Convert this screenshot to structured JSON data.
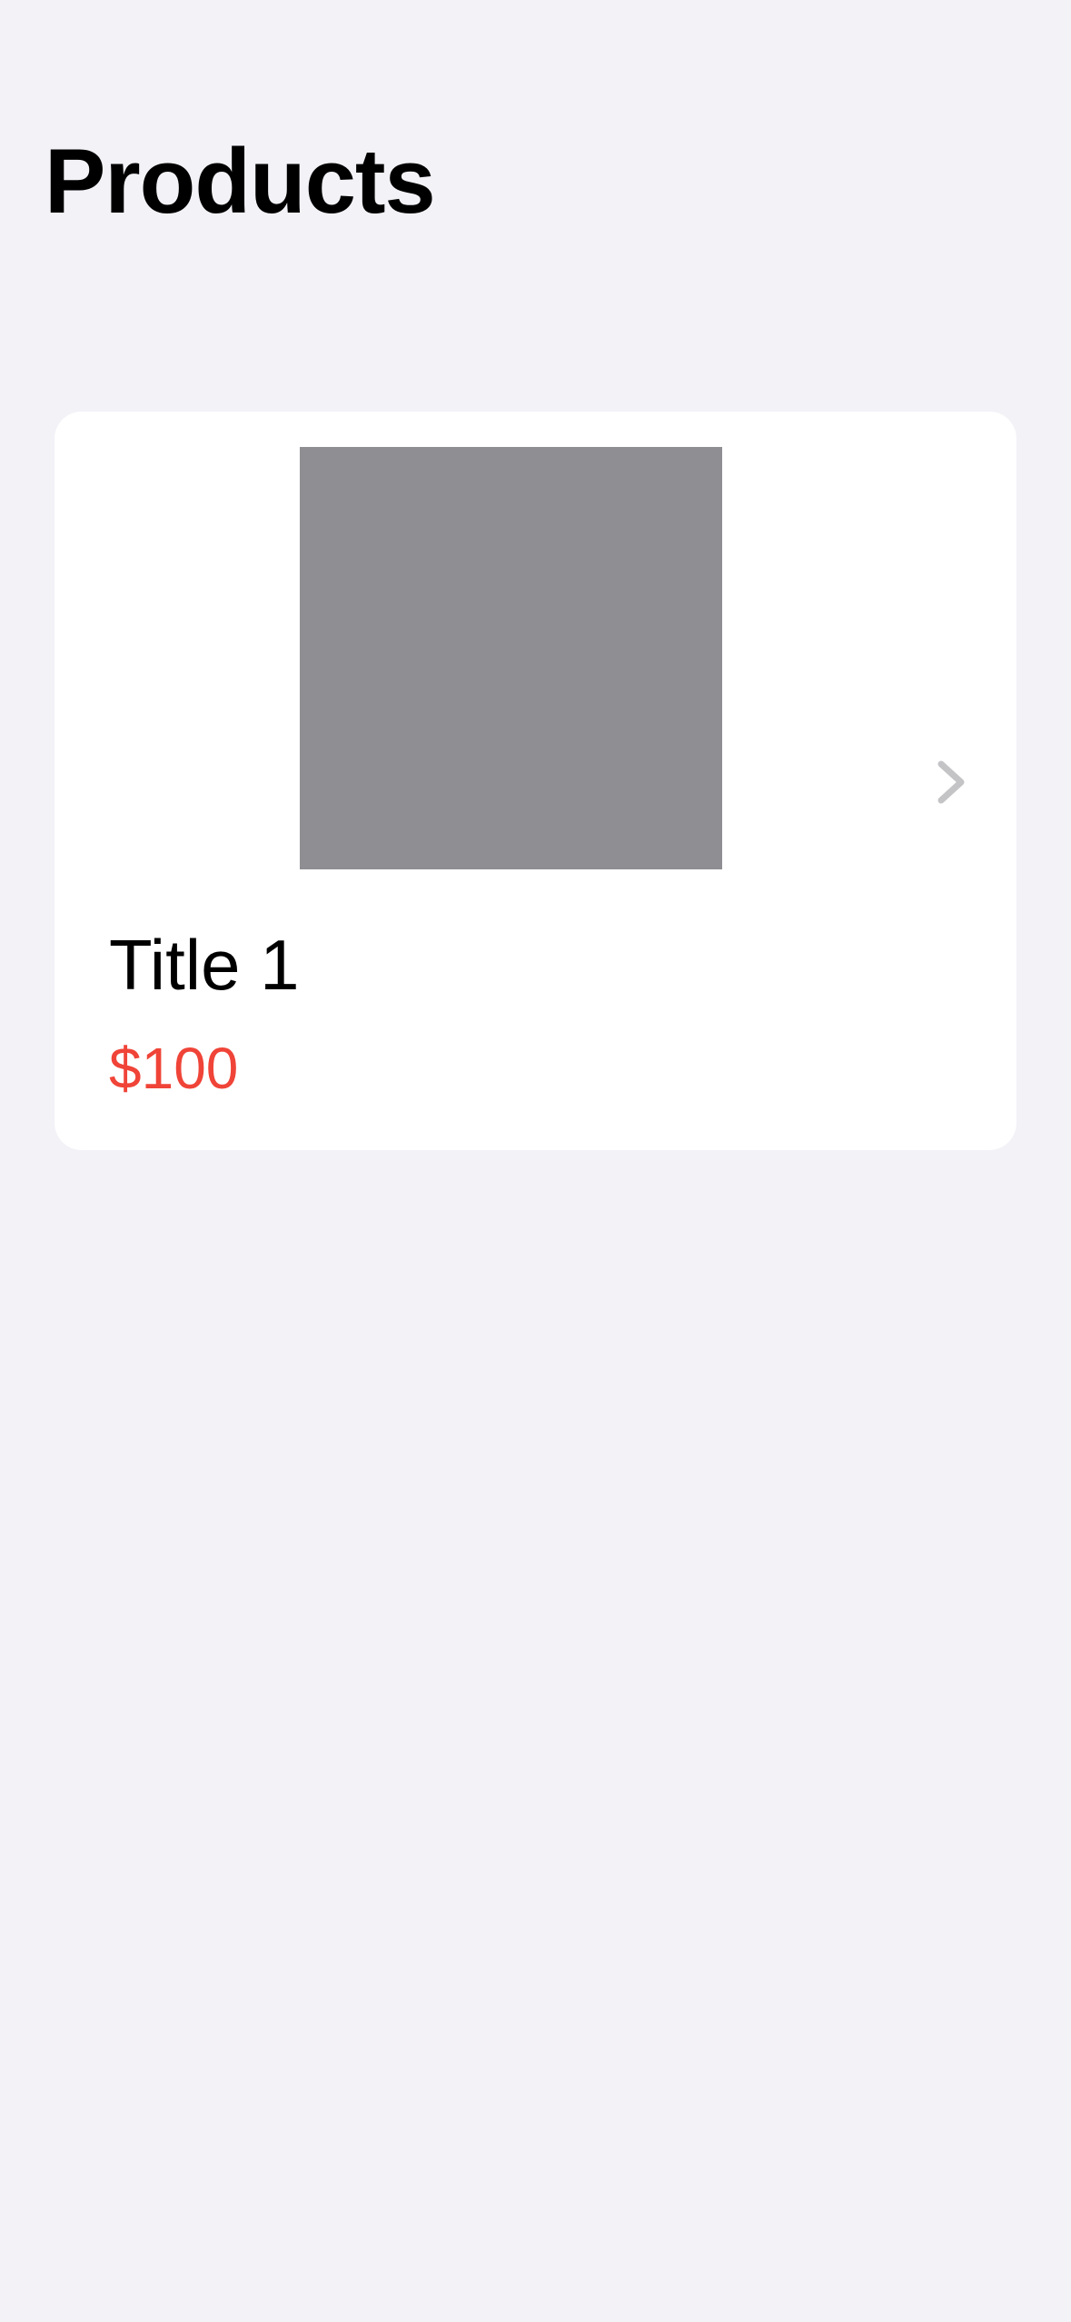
{
  "header": {
    "title": "Products"
  },
  "products": [
    {
      "title": "Title 1",
      "price": "$100",
      "image_placeholder_color": "#8E8E93",
      "disclosure_icon": "chevron-right-icon"
    }
  ],
  "colors": {
    "background": "#F2F2F7",
    "card": "#FFFFFF",
    "price": "#F04438",
    "chevron": "#C4C4C7"
  }
}
